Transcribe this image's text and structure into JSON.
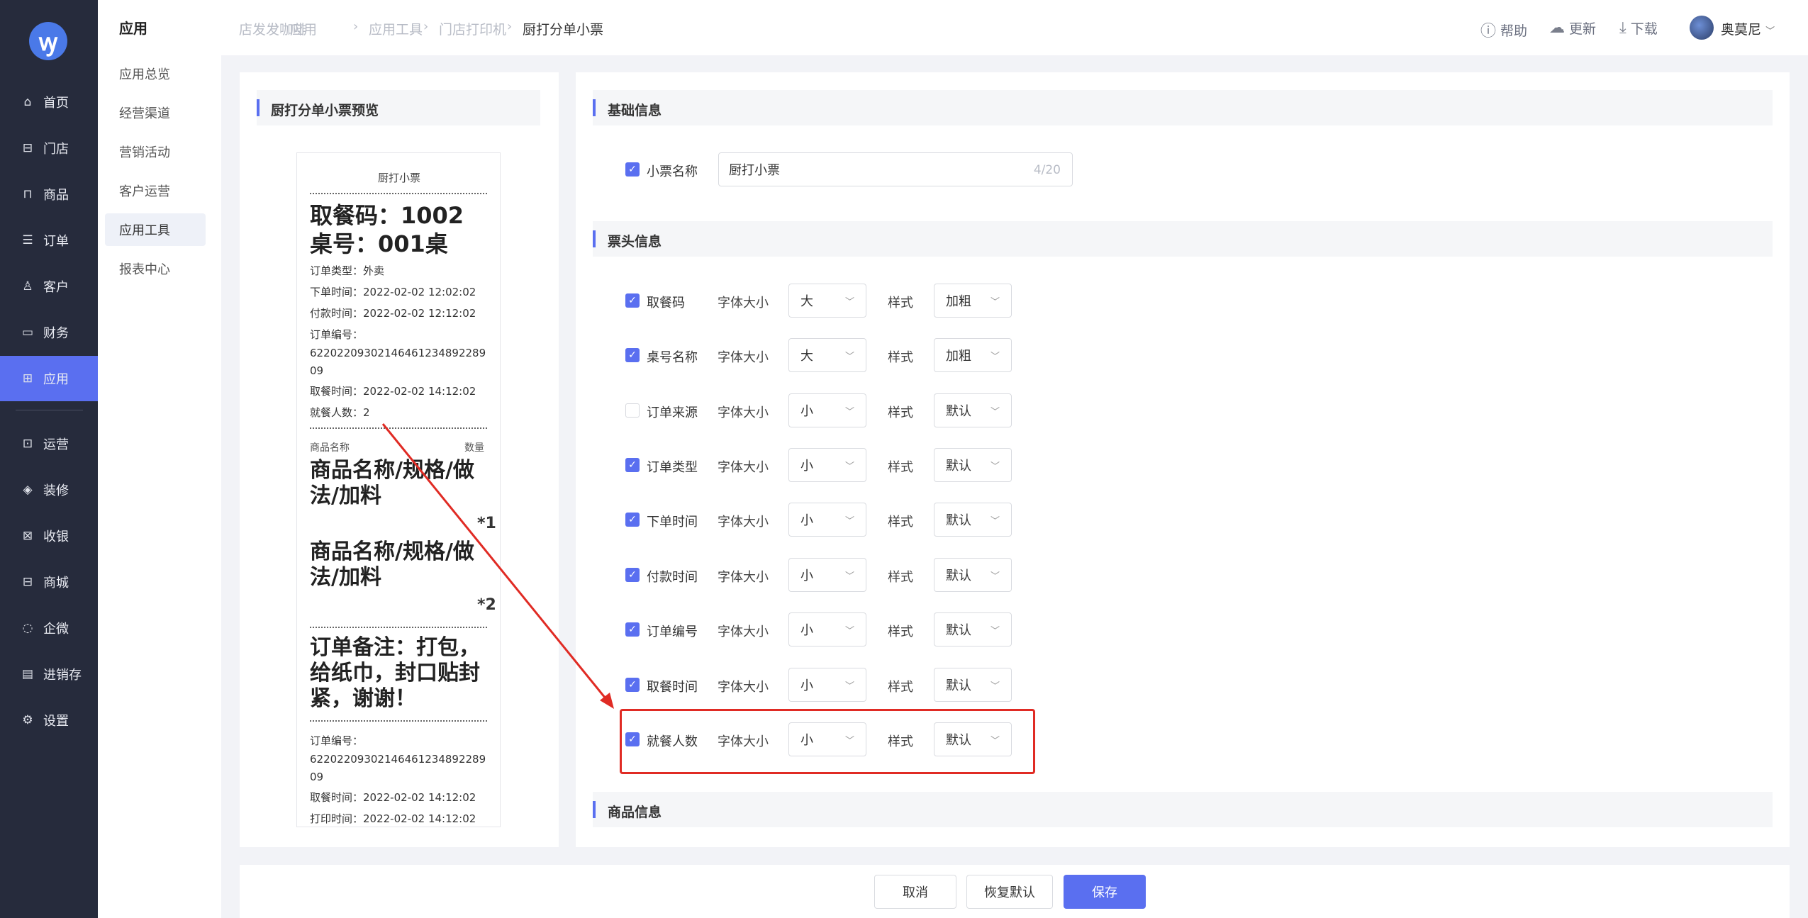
{
  "sidebar": {
    "logo": "ꝡ",
    "items": [
      {
        "label": "首页",
        "icon": "home-icon",
        "glyph": "⌂"
      },
      {
        "label": "门店",
        "icon": "store-icon",
        "glyph": "⊟"
      },
      {
        "label": "商品",
        "icon": "bag-icon",
        "glyph": "⊓"
      },
      {
        "label": "订单",
        "icon": "order-icon",
        "glyph": "☰"
      },
      {
        "label": "客户",
        "icon": "user-icon",
        "glyph": "♙"
      },
      {
        "label": "财务",
        "icon": "wallet-icon",
        "glyph": "▭"
      },
      {
        "label": "应用",
        "icon": "apps-icon",
        "glyph": "⊞"
      },
      {
        "label": "运营",
        "icon": "gift-icon",
        "glyph": "⊡"
      },
      {
        "label": "装修",
        "icon": "layers-icon",
        "glyph": "◈"
      },
      {
        "label": "收银",
        "icon": "cashier-icon",
        "glyph": "⊠"
      },
      {
        "label": "商城",
        "icon": "mall-icon",
        "glyph": "⊟"
      },
      {
        "label": "企微",
        "icon": "chat-icon",
        "glyph": "◌"
      },
      {
        "label": "进销存",
        "icon": "inventory-icon",
        "glyph": "▤"
      },
      {
        "label": "设置",
        "icon": "settings-icon",
        "glyph": "⚙"
      }
    ]
  },
  "subnav": {
    "title": "应用",
    "items": [
      "应用总览",
      "经营渠道",
      "营销活动",
      "客户运营",
      "应用工具",
      "报表中心"
    ]
  },
  "breadcrumb": [
    "店发发咖啡",
    "应用",
    "应用工具",
    "门店打印机",
    "厨打分单小票"
  ],
  "topbar": {
    "help": "帮助",
    "update": "更新",
    "download": "下载",
    "user": "奥莫尼"
  },
  "preview": {
    "title": "厨打分单小票预览",
    "receipt": {
      "name": "厨打小票",
      "pickup": "取餐码：1002",
      "table": "桌号：001桌",
      "order_type": "订单类型：外卖",
      "order_time": "下单时间：2022-02-02 12:02:02",
      "pay_time": "付款时间：2022-02-02 12:12:02",
      "order_no_label": "订单编号：",
      "order_no": "6220220930214646123489228909",
      "pickup_time": "取餐时间：2022-02-02 14:12:02",
      "diners": "就餐人数：2",
      "col_name": "商品名称",
      "col_qty": "数量",
      "item1": "商品名称/规格/做法/加料",
      "item1_qty": "*1",
      "item2": "商品名称/规格/做法/加料",
      "item2_qty": "*2",
      "note": "订单备注：打包，给纸巾，封口贴封紧，谢谢！",
      "footer_order_no_label": "订单编号：",
      "footer_order_no": "6220220930214646123489228909",
      "footer_pickup_time": "取餐时间：2022-02-02 14:12:02",
      "footer_print_time": "打印时间：2022-02-02 14:12:02"
    }
  },
  "basic": {
    "title": "基础信息",
    "name_label": "小票名称",
    "name_value": "厨打小票",
    "name_count": "4/20"
  },
  "header_section": {
    "title": "票头信息",
    "size_label": "字体大小",
    "style_label": "样式",
    "rows": [
      {
        "label": "取餐码",
        "checked": true,
        "size": "大",
        "style": "加粗"
      },
      {
        "label": "桌号名称",
        "checked": true,
        "size": "大",
        "style": "加粗"
      },
      {
        "label": "订单来源",
        "checked": false,
        "size": "小",
        "style": "默认"
      },
      {
        "label": "订单类型",
        "checked": true,
        "size": "小",
        "style": "默认"
      },
      {
        "label": "下单时间",
        "checked": true,
        "size": "小",
        "style": "默认"
      },
      {
        "label": "付款时间",
        "checked": true,
        "size": "小",
        "style": "默认"
      },
      {
        "label": "订单编号",
        "checked": true,
        "size": "小",
        "style": "默认"
      },
      {
        "label": "取餐时间",
        "checked": true,
        "size": "小",
        "style": "默认"
      },
      {
        "label": "就餐人数",
        "checked": true,
        "size": "小",
        "style": "默认"
      }
    ]
  },
  "goods": {
    "title": "商品信息"
  },
  "footer": {
    "cancel": "取消",
    "reset": "恢复默认",
    "save": "保存"
  },
  "colors": {
    "accent": "#5a6ff0",
    "sidebar": "#262b3c",
    "highlight": "#e02b24"
  }
}
